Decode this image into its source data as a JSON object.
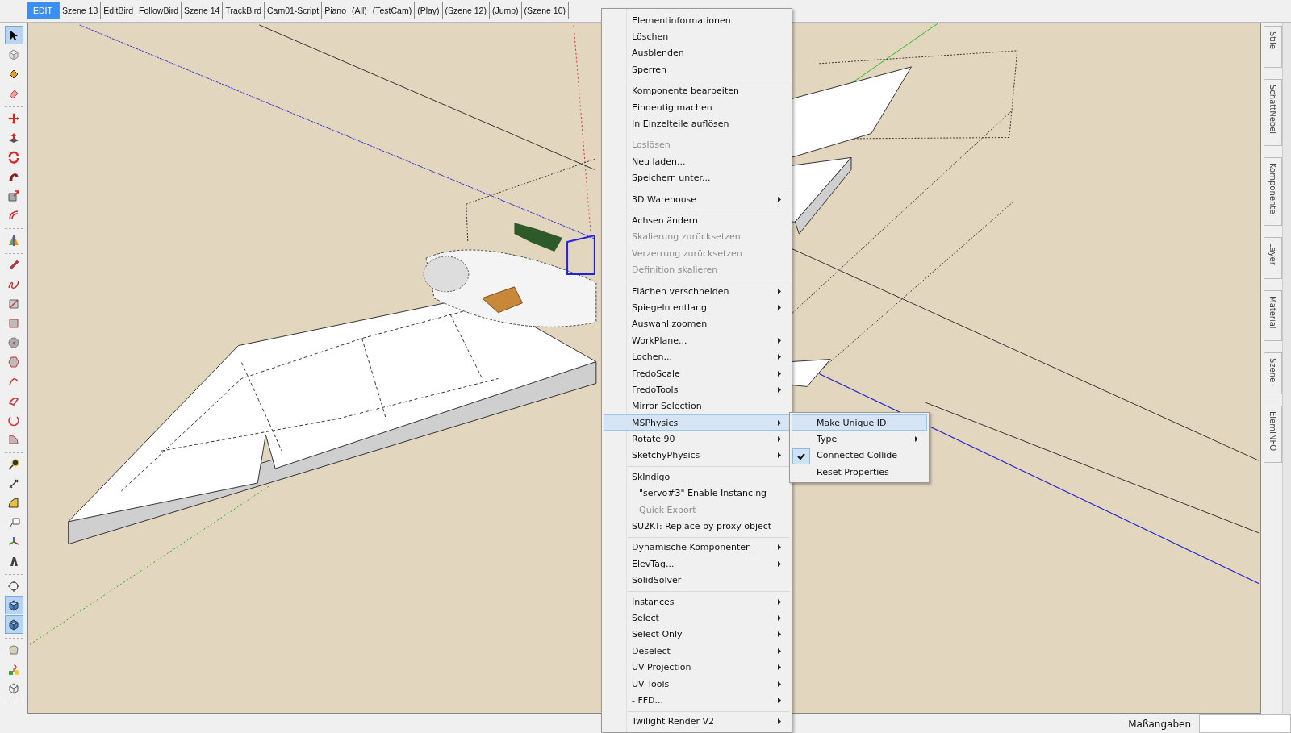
{
  "scene_tabs": [
    {
      "label": "EDIT",
      "selected": true
    },
    {
      "label": "Szene 13",
      "selected": false
    },
    {
      "label": "EditBird",
      "selected": false
    },
    {
      "label": "FollowBird",
      "selected": false
    },
    {
      "label": "Szene 14",
      "selected": false
    },
    {
      "label": "TrackBird",
      "selected": false
    },
    {
      "label": "Cam01-Script",
      "selected": false
    },
    {
      "label": "Piano",
      "selected": false
    },
    {
      "label": "(All)",
      "selected": false
    },
    {
      "label": "(TestCam)",
      "selected": false
    },
    {
      "label": "(Play)",
      "selected": false
    },
    {
      "label": "(Szene 12)",
      "selected": false
    },
    {
      "label": "(Jump)",
      "selected": false
    },
    {
      "label": "(Szene 10)",
      "selected": false
    }
  ],
  "toolbar": {
    "groups": [
      [
        {
          "selected": true
        },
        {
          "selected": false
        },
        {
          "selected": false
        },
        {
          "selected": false
        }
      ],
      [
        {
          "selected": false
        },
        {
          "selected": false
        },
        {
          "selected": false
        },
        {
          "selected": false
        },
        {
          "selected": false
        },
        {
          "selected": false
        }
      ],
      [
        {
          "selected": false
        }
      ],
      [
        {
          "selected": false
        },
        {
          "selected": false
        },
        {
          "selected": false
        },
        {
          "selected": false
        },
        {
          "selected": false
        },
        {
          "selected": false
        },
        {
          "selected": false
        },
        {
          "selected": false
        },
        {
          "selected": false
        },
        {
          "selected": false
        }
      ],
      [
        {
          "selected": false
        },
        {
          "selected": false
        },
        {
          "selected": false
        },
        {
          "selected": false
        },
        {
          "selected": false
        },
        {
          "selected": false
        }
      ],
      [
        {
          "selected": false
        },
        {
          "selected": true
        },
        {
          "selected": true
        }
      ],
      [
        {
          "selected": false
        },
        {
          "selected": false
        },
        {
          "selected": false
        }
      ]
    ]
  },
  "side_tabs": [
    "Stile",
    "SchattNebel",
    "Komponente",
    "Layer",
    "Material",
    "Szene",
    "ElemINFO"
  ],
  "context_menu": {
    "sections": [
      [
        {
          "label": "Elementinformationen",
          "kind": "entry",
          "disabled": false,
          "submenu": false,
          "selected": false
        },
        {
          "label": "Löschen",
          "kind": "entry",
          "disabled": false,
          "submenu": false,
          "selected": false
        },
        {
          "label": "Ausblenden",
          "kind": "entry",
          "disabled": false,
          "submenu": false,
          "selected": false
        },
        {
          "label": "Sperren",
          "kind": "entry",
          "disabled": false,
          "submenu": false,
          "selected": false
        }
      ],
      [
        {
          "label": "Komponente bearbeiten",
          "kind": "entry",
          "disabled": false,
          "submenu": false,
          "selected": false
        },
        {
          "label": "Eindeutig machen",
          "kind": "entry",
          "disabled": false,
          "submenu": false,
          "selected": false
        },
        {
          "label": "In Einzelteile auflösen",
          "kind": "entry",
          "disabled": false,
          "submenu": false,
          "selected": false
        }
      ],
      [
        {
          "label": "Loslösen",
          "kind": "entry",
          "disabled": true,
          "submenu": false,
          "selected": false
        },
        {
          "label": "Neu laden...",
          "kind": "entry",
          "disabled": false,
          "submenu": false,
          "selected": false
        },
        {
          "label": "Speichern unter...",
          "kind": "entry",
          "disabled": false,
          "submenu": false,
          "selected": false
        }
      ],
      [
        {
          "label": "3D Warehouse",
          "kind": "entry",
          "disabled": false,
          "submenu": true,
          "selected": false
        }
      ],
      [
        {
          "label": "Achsen ändern",
          "kind": "entry",
          "disabled": false,
          "submenu": false,
          "selected": false
        },
        {
          "label": "Skalierung zurücksetzen",
          "kind": "entry",
          "disabled": true,
          "submenu": false,
          "selected": false
        },
        {
          "label": "Verzerrung zurücksetzen",
          "kind": "entry",
          "disabled": true,
          "submenu": false,
          "selected": false
        },
        {
          "label": "Definition skalieren",
          "kind": "entry",
          "disabled": true,
          "submenu": false,
          "selected": false
        }
      ],
      [
        {
          "label": "Flächen verschneiden",
          "kind": "entry",
          "disabled": false,
          "submenu": true,
          "selected": false
        },
        {
          "label": "Spiegeln entlang",
          "kind": "entry",
          "disabled": false,
          "submenu": true,
          "selected": false
        },
        {
          "label": "Auswahl zoomen",
          "kind": "entry",
          "disabled": false,
          "submenu": false,
          "selected": false
        },
        {
          "label": "WorkPlane...",
          "kind": "entry",
          "disabled": false,
          "submenu": true,
          "selected": false
        },
        {
          "label": "Lochen...",
          "kind": "entry",
          "disabled": false,
          "submenu": true,
          "selected": false
        },
        {
          "label": "FredoScale",
          "kind": "entry",
          "disabled": false,
          "submenu": true,
          "selected": false
        },
        {
          "label": "FredoTools",
          "kind": "entry",
          "disabled": false,
          "submenu": true,
          "selected": false
        },
        {
          "label": "Mirror Selection",
          "kind": "entry",
          "disabled": false,
          "submenu": false,
          "selected": false
        },
        {
          "label": "MSPhysics",
          "kind": "entry",
          "disabled": false,
          "submenu": true,
          "selected": true
        },
        {
          "label": "Rotate 90",
          "kind": "entry",
          "disabled": false,
          "submenu": true,
          "selected": false
        },
        {
          "label": "SketchyPhysics",
          "kind": "entry",
          "disabled": false,
          "submenu": true,
          "selected": false
        }
      ],
      [
        {
          "label": "SkIndigo",
          "kind": "entry",
          "disabled": false,
          "submenu": false,
          "selected": false
        },
        {
          "label": "\"servo#3\" Enable Instancing",
          "kind": "indented",
          "disabled": false,
          "submenu": false,
          "selected": false
        },
        {
          "label": "Quick Export",
          "kind": "indented",
          "disabled": true,
          "submenu": false,
          "selected": false
        },
        {
          "label": "SU2KT: Replace by proxy object",
          "kind": "entry",
          "disabled": false,
          "submenu": false,
          "selected": false
        }
      ],
      [
        {
          "label": "Dynamische Komponenten",
          "kind": "entry",
          "disabled": false,
          "submenu": true,
          "selected": false
        },
        {
          "label": "ElevTag...",
          "kind": "entry",
          "disabled": false,
          "submenu": true,
          "selected": false
        },
        {
          "label": "SolidSolver",
          "kind": "entry",
          "disabled": false,
          "submenu": false,
          "selected": false
        }
      ],
      [
        {
          "label": "Instances",
          "kind": "entry",
          "disabled": false,
          "submenu": true,
          "selected": false
        },
        {
          "label": "Select",
          "kind": "entry",
          "disabled": false,
          "submenu": true,
          "selected": false
        },
        {
          "label": "Select Only",
          "kind": "entry",
          "disabled": false,
          "submenu": true,
          "selected": false
        },
        {
          "label": "Deselect",
          "kind": "entry",
          "disabled": false,
          "submenu": true,
          "selected": false
        },
        {
          "label": "UV Projection",
          "kind": "entry",
          "disabled": false,
          "submenu": true,
          "selected": false
        },
        {
          "label": "UV Tools",
          "kind": "entry",
          "disabled": false,
          "submenu": true,
          "selected": false
        },
        {
          "label": "- FFD...",
          "kind": "entry",
          "disabled": false,
          "submenu": true,
          "selected": false
        }
      ],
      [
        {
          "label": "Twilight Render V2",
          "kind": "entry",
          "disabled": false,
          "submenu": true,
          "selected": false
        }
      ]
    ]
  },
  "submenu": {
    "items": [
      {
        "label": "Make Unique ID",
        "submenu": false,
        "checked": false,
        "selected": true
      },
      {
        "label": "Type",
        "submenu": true,
        "checked": false,
        "selected": false
      },
      {
        "label": "Connected Collide",
        "submenu": false,
        "checked": true,
        "selected": false
      },
      {
        "label": "Reset Properties",
        "submenu": false,
        "checked": false,
        "selected": false
      }
    ]
  },
  "status_bar": {
    "measurements_label": "Maßangaben"
  }
}
